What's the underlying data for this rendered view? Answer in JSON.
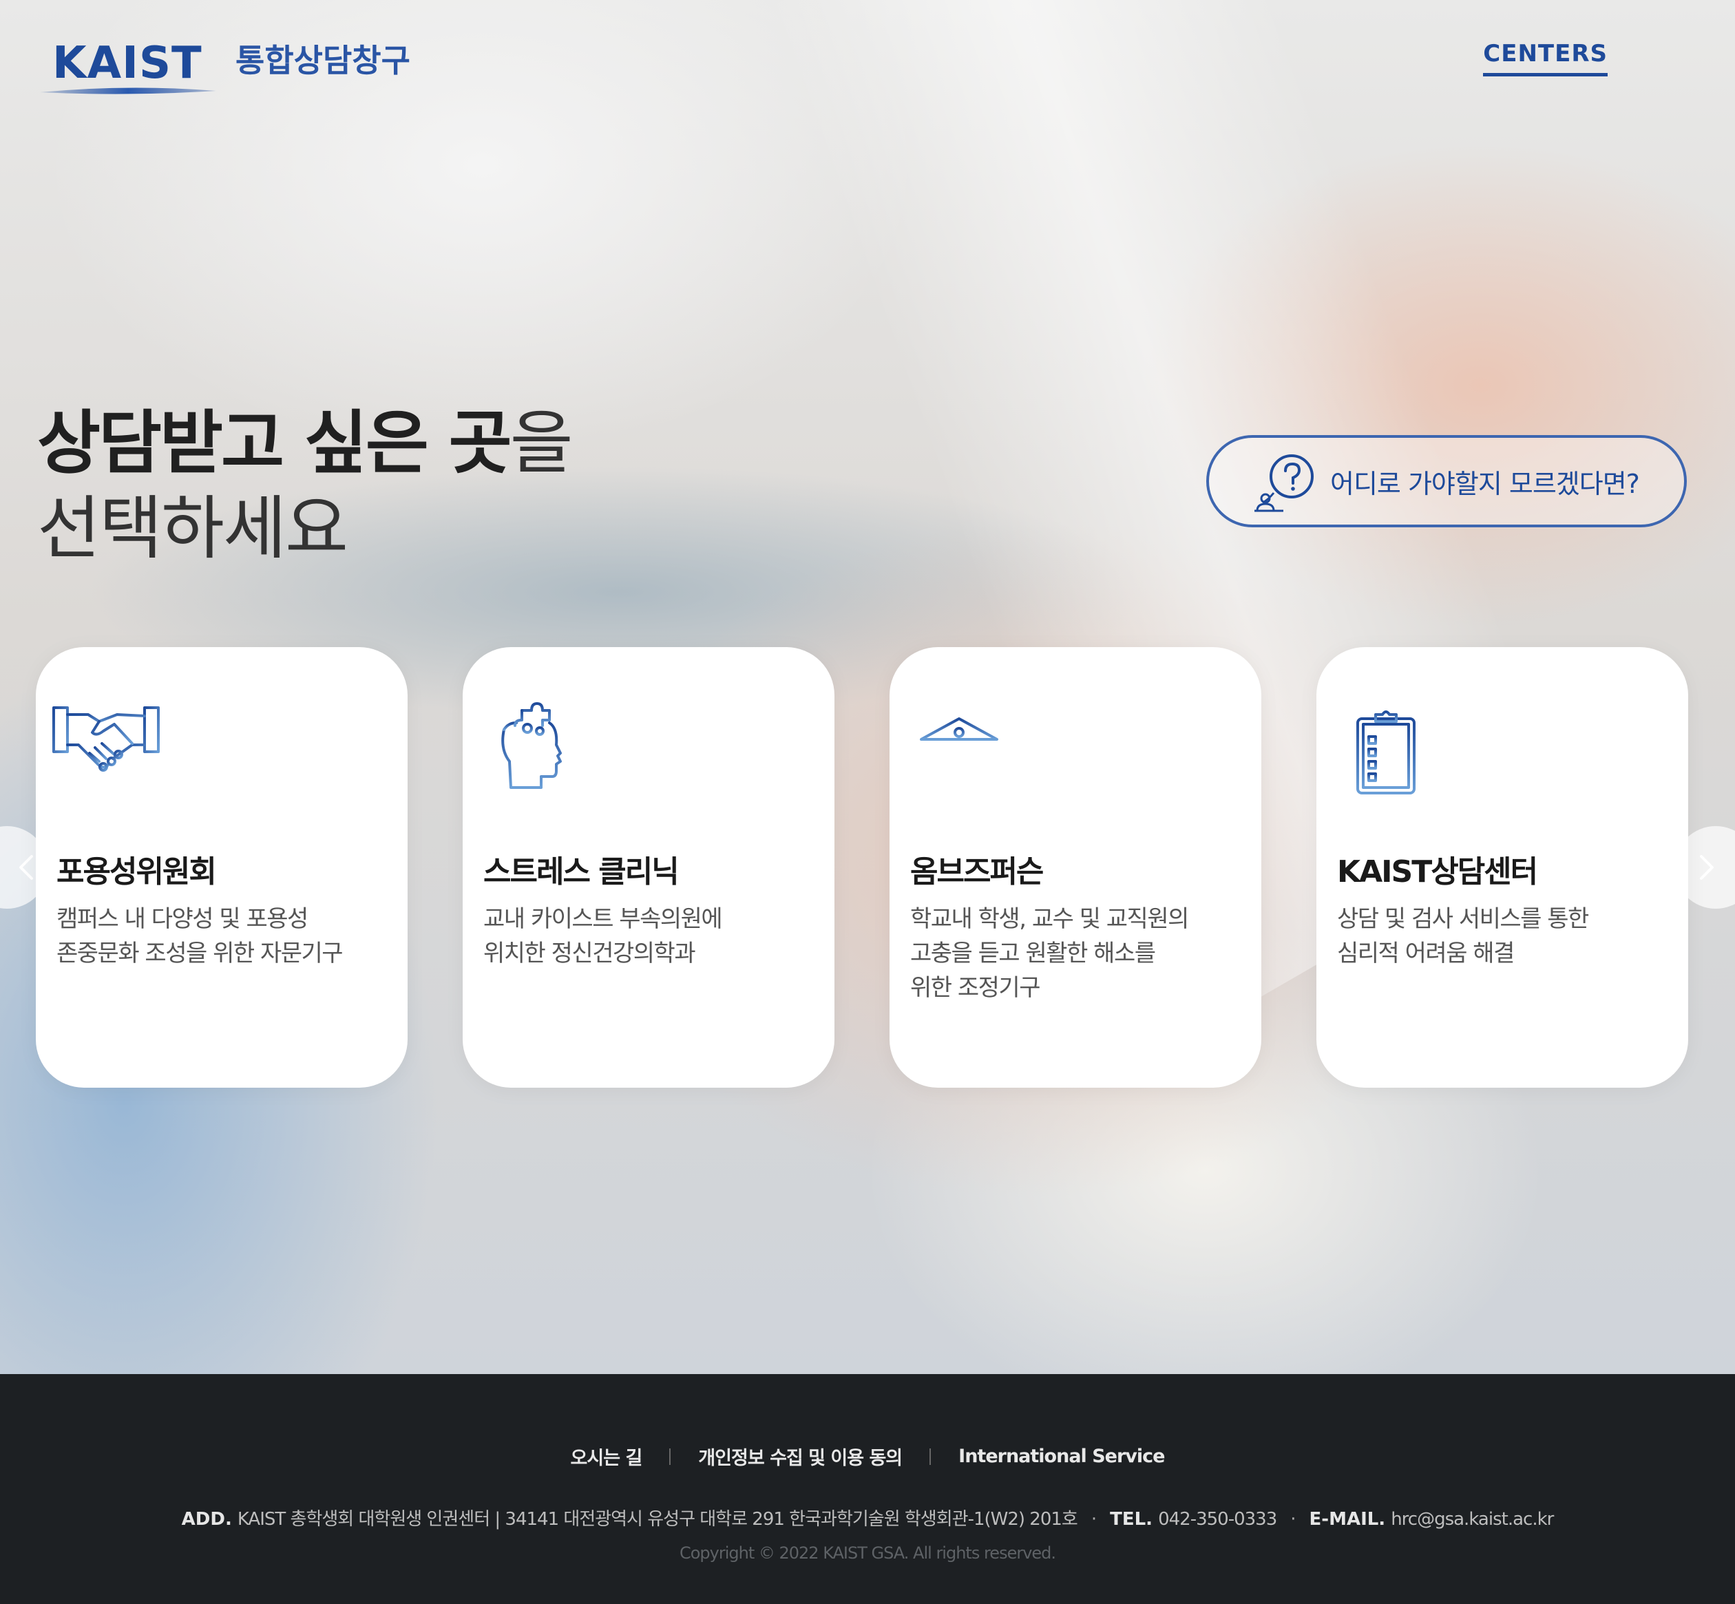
{
  "header": {
    "logo_text": "KAIST",
    "service_name": "통합상담창구",
    "centers_link": "CENTERS"
  },
  "headline": {
    "line1_strong": "상담받고 싶은 곳",
    "line1_rest": "을",
    "line2": "선택하세요"
  },
  "help_button": {
    "label": "어디로 가야할지 모르겠다면?",
    "icon": "question-counselor-icon"
  },
  "cards": [
    {
      "title": "포용성위원회",
      "desc_line1": "캠퍼스 내 다양성 및 포용성",
      "desc_line2": "존중문화 조성을 위한 자문기구",
      "desc_line3": "",
      "icon": "handshake-icon"
    },
    {
      "title": "스트레스 클리닉",
      "desc_line1": "교내 카이스트 부속의원에",
      "desc_line2": "위치한 정신건강의학과",
      "desc_line3": "",
      "icon": "head-puzzle-icon"
    },
    {
      "title": "옴브즈퍼슨",
      "desc_line1": "학교내 학생, 교수 및 교직원의",
      "desc_line2": "고충을 듣고 원활한 해소를",
      "desc_line3": "위한 조정기구",
      "icon": "building-columns-icon"
    },
    {
      "title": "KAIST상담센터",
      "desc_line1": "상담 및 검사 서비스를 통한",
      "desc_line2": "심리적 어려움 해결",
      "desc_line3": "",
      "icon": "clipboard-checklist-icon"
    }
  ],
  "carousel": {
    "prev_icon": "chevron-left-icon",
    "next_icon": "chevron-right-icon"
  },
  "footer": {
    "links": [
      "오시는 길",
      "개인정보 수집 및 이용 동의",
      "International Service"
    ],
    "add_label": "ADD.",
    "address": "KAIST 총학생회 대학원생 인권센터 | 34141 대전광역시 유성구 대학로 291 한국과학기술원 학생회관-1(W2) 201호",
    "tel_label": "TEL.",
    "tel": "042-350-0333",
    "email_label": "E-MAIL.",
    "email": "hrc@gsa.kaist.ac.kr",
    "separator": "·",
    "copyright": "Copyright © 2022 KAIST GSA. All rights reserved."
  },
  "colors": {
    "brand_blue": "#1e4a9a",
    "footer_bg": "#1d2023",
    "card_bg": "#ffffff"
  }
}
